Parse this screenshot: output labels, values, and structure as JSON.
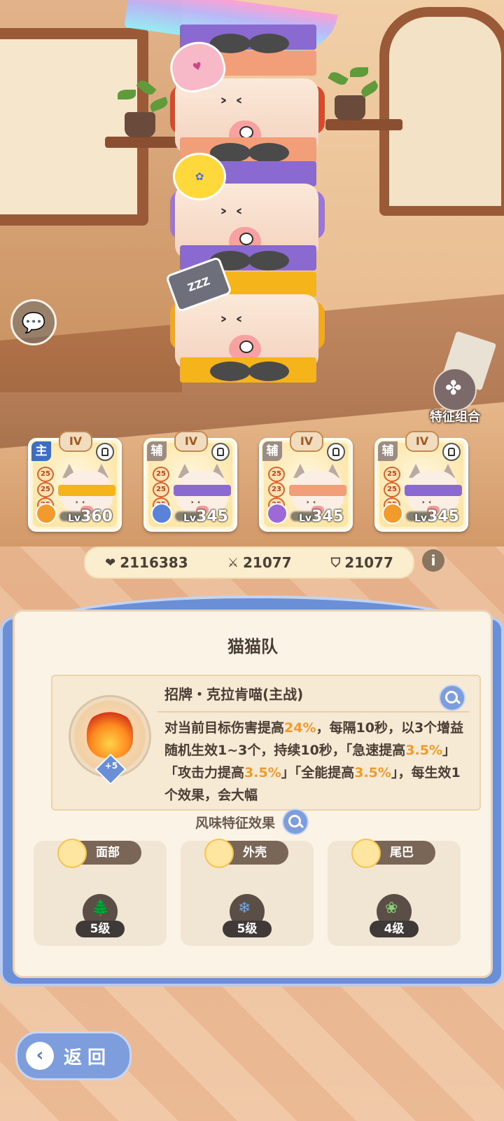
{
  "screen": {
    "chat_icon": "chat-bubbles-icon",
    "feature_icon": "clover-icon"
  },
  "feature_combo": {
    "label": "特征组合"
  },
  "team": [
    {
      "role": "主",
      "tier": "IV",
      "badges": [
        "25",
        "25",
        "25"
      ],
      "level_prefix": "Lv",
      "level": "360",
      "band_color": "#f5b51a",
      "paw_color": "#f29a2b",
      "role_color": "main"
    },
    {
      "role": "辅",
      "tier": "IV",
      "badges": [
        "25",
        "25",
        "25"
      ],
      "level_prefix": "Lv",
      "level": "345",
      "band_color": "#8a6ad0",
      "paw_color": "#5a82d8",
      "role_color": "sup"
    },
    {
      "role": "辅",
      "tier": "IV",
      "badges": [
        "25",
        "23",
        "25"
      ],
      "level_prefix": "Lv",
      "level": "345",
      "band_color": "#f29e78",
      "paw_color": "#9b6ad6",
      "role_color": "sup"
    },
    {
      "role": "辅",
      "tier": "IV",
      "badges": [
        "25",
        "25",
        "25"
      ],
      "level_prefix": "Lv",
      "level": "345",
      "band_color": "#8a6ad0",
      "paw_color": "#f29a2b",
      "role_color": "sup"
    }
  ],
  "stats": {
    "hp": "2116383",
    "attack": "21077",
    "defense": "21077",
    "info_label": "i"
  },
  "panel": {
    "title": "猫猫队",
    "skill": {
      "name": "招牌・克拉肯喵(主战)",
      "badge": "+5",
      "desc_parts": {
        "p1": "对当前目标伤害提高",
        "v1": "24%",
        "p2": "，每隔10秒，以3个增益随机生效1~3个，持续10秒，「急速提高",
        "v2": "3.5%",
        "p3": "」「攻击力提高",
        "v3": "3.5%",
        "p4": "」「全能提高",
        "v4": "3.5%",
        "p5": "」，每生效1个效果，会大幅"
      }
    },
    "flavor_title": "风味特征效果",
    "traits": [
      {
        "label": "面部",
        "level": "5级",
        "medal_icon": "tree-icon",
        "medal_glyph": "🌲"
      },
      {
        "label": "外壳",
        "level": "5级",
        "medal_icon": "snowflake-icon",
        "medal_glyph": "❄"
      },
      {
        "label": "尾巴",
        "level": "4级",
        "medal_icon": "leaf-icon",
        "medal_glyph": "❀"
      }
    ]
  },
  "back": {
    "label": "返回",
    "icon": "back-arrow-icon",
    "glyph": "‹"
  },
  "colors": {
    "accent_blue": "#6a8fd6",
    "highlight": "#f19a2b",
    "text_dark": "#4a3d34"
  }
}
